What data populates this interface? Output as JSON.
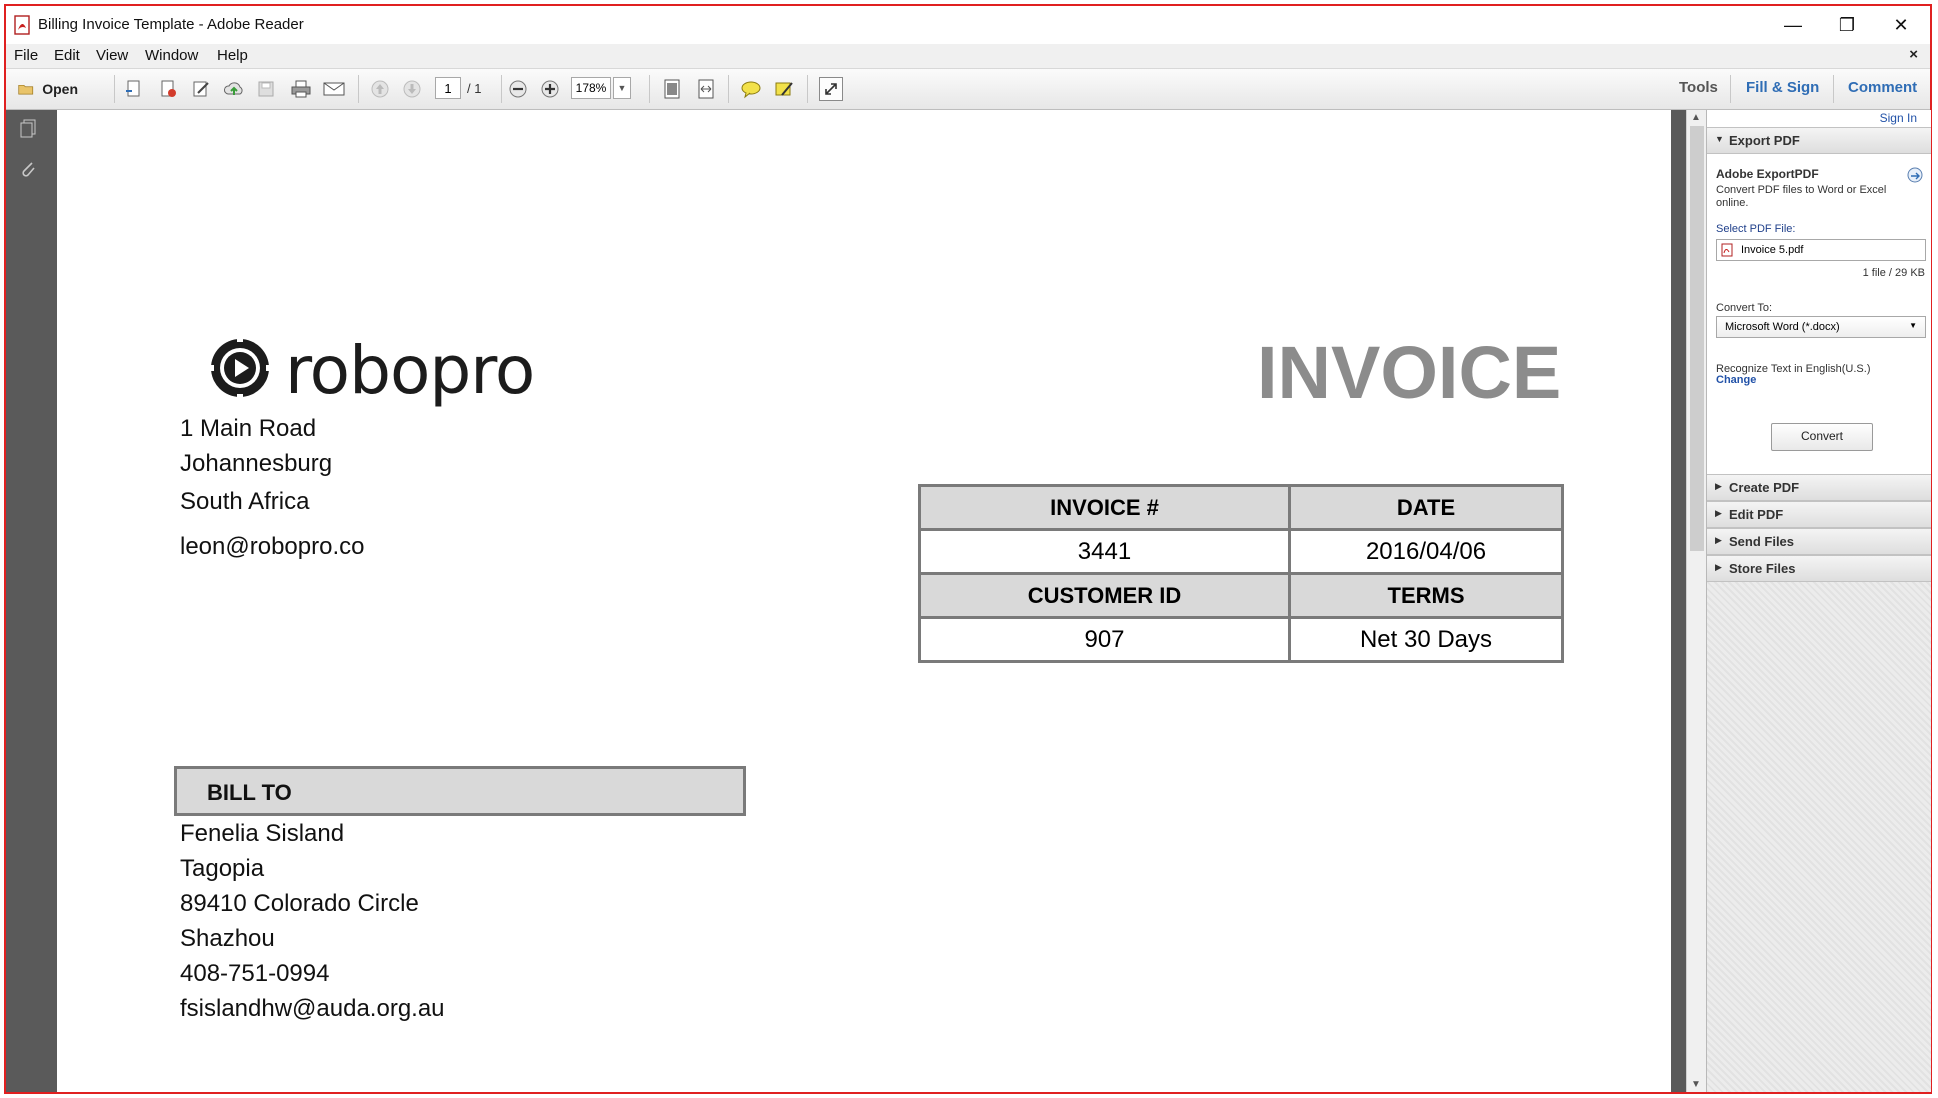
{
  "window": {
    "title": "Billing Invoice Template - Adobe Reader",
    "minimize": "—",
    "restore": "❐",
    "close": "✕"
  },
  "menu": [
    "File",
    "Edit",
    "View",
    "Window",
    "Help"
  ],
  "menu_close": "×",
  "toolbar": {
    "open_label": "Open",
    "current_page": "1",
    "page_total": "/ 1",
    "zoom": "178%",
    "tools_label": "Tools",
    "fill_sign_label": "Fill & Sign",
    "comment_label": "Comment",
    "colors": {
      "tools": "#555555",
      "fill_sign": "#2f6db5",
      "comment": "#2f6db5"
    }
  },
  "document": {
    "logo_text": "robopro",
    "invoice_title": "INVOICE",
    "company_address": [
      "1 Main Road",
      "Johannesburg",
      "South Africa",
      "leon@robopro.co"
    ],
    "invoice_table": {
      "headers_row1": [
        "INVOICE #",
        "DATE"
      ],
      "values_row1": [
        "3441",
        "2016/04/06"
      ],
      "headers_row2": [
        "CUSTOMER ID",
        "TERMS"
      ],
      "values_row2": [
        "907",
        "Net 30 Days"
      ]
    },
    "bill_to_label": "BILL TO",
    "bill_to": [
      "Fenelia Sisland",
      "Tagopia",
      "89410 Colorado Circle",
      "Shazhou",
      "408-751-0994",
      "fsislandhw@auda.org.au"
    ]
  },
  "right_pane": {
    "sign_in": "Sign In",
    "export_pdf": "Export PDF",
    "adobe_exportpdf": "Adobe ExportPDF",
    "export_desc": "Convert PDF files to Word or Excel online.",
    "select_pdf_label": "Select PDF File:",
    "selected_file": "Invoice 5.pdf",
    "file_info": "1 file / 29 KB",
    "convert_to_label": "Convert To:",
    "convert_to_value": "Microsoft Word (*.docx)",
    "recognize_text": "Recognize Text in English(U.S.)",
    "change_link": "Change",
    "convert_button": "Convert",
    "sections": [
      "Create PDF",
      "Edit PDF",
      "Send Files",
      "Store Files"
    ]
  }
}
